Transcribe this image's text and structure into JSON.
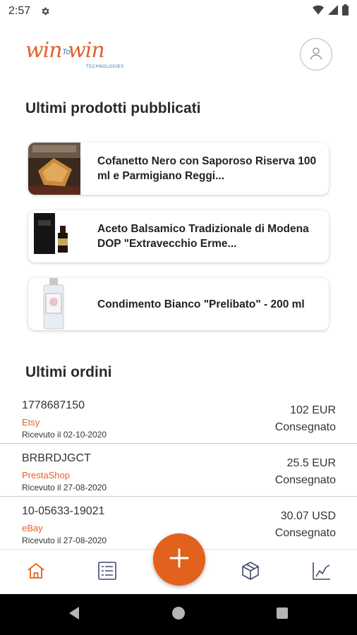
{
  "status_bar": {
    "time": "2:57",
    "icons": [
      "gear-icon",
      "wifi-icon",
      "signal-icon",
      "battery-icon"
    ]
  },
  "header": {
    "logo_main": "win win",
    "logo_to": "To",
    "logo_sub": "TECHNOLOGIES",
    "profile_icon": "user-icon"
  },
  "products": {
    "title": "Ultimi prodotti pubblicati",
    "items": [
      {
        "name": "Cofanetto Nero con Saporoso Riserva 100 ml e Parmigiano Reggi..."
      },
      {
        "name": "Aceto Balsamico Tradizionale di Modena DOP \"Extravecchio Erme..."
      },
      {
        "name": "Condimento Bianco \"Prelibato\" - 200 ml"
      }
    ]
  },
  "orders": {
    "title": "Ultimi ordini",
    "items": [
      {
        "id": "1778687150",
        "source": "Etsy",
        "date": "Ricevuto il 02-10-2020",
        "amount": "102 EUR",
        "status": "Consegnato"
      },
      {
        "id": "BRBRDJGCT",
        "source": "PrestaShop",
        "date": "Ricevuto il 27-08-2020",
        "amount": "25.5 EUR",
        "status": "Consegnato"
      },
      {
        "id": "10-05633-19021",
        "source": "eBay",
        "date": "Ricevuto il 27-08-2020",
        "amount": "30.07 USD",
        "status": "Consegnato"
      }
    ]
  },
  "bottom_nav": {
    "items": [
      "home-icon",
      "list-icon",
      "box-icon",
      "chart-icon"
    ],
    "fab_icon": "plus-icon"
  },
  "system_nav": {
    "items": [
      "back-icon",
      "home-circle-icon",
      "recents-icon"
    ]
  },
  "colors": {
    "accent": "#e2611c",
    "brand_blue": "#2e72b8"
  }
}
